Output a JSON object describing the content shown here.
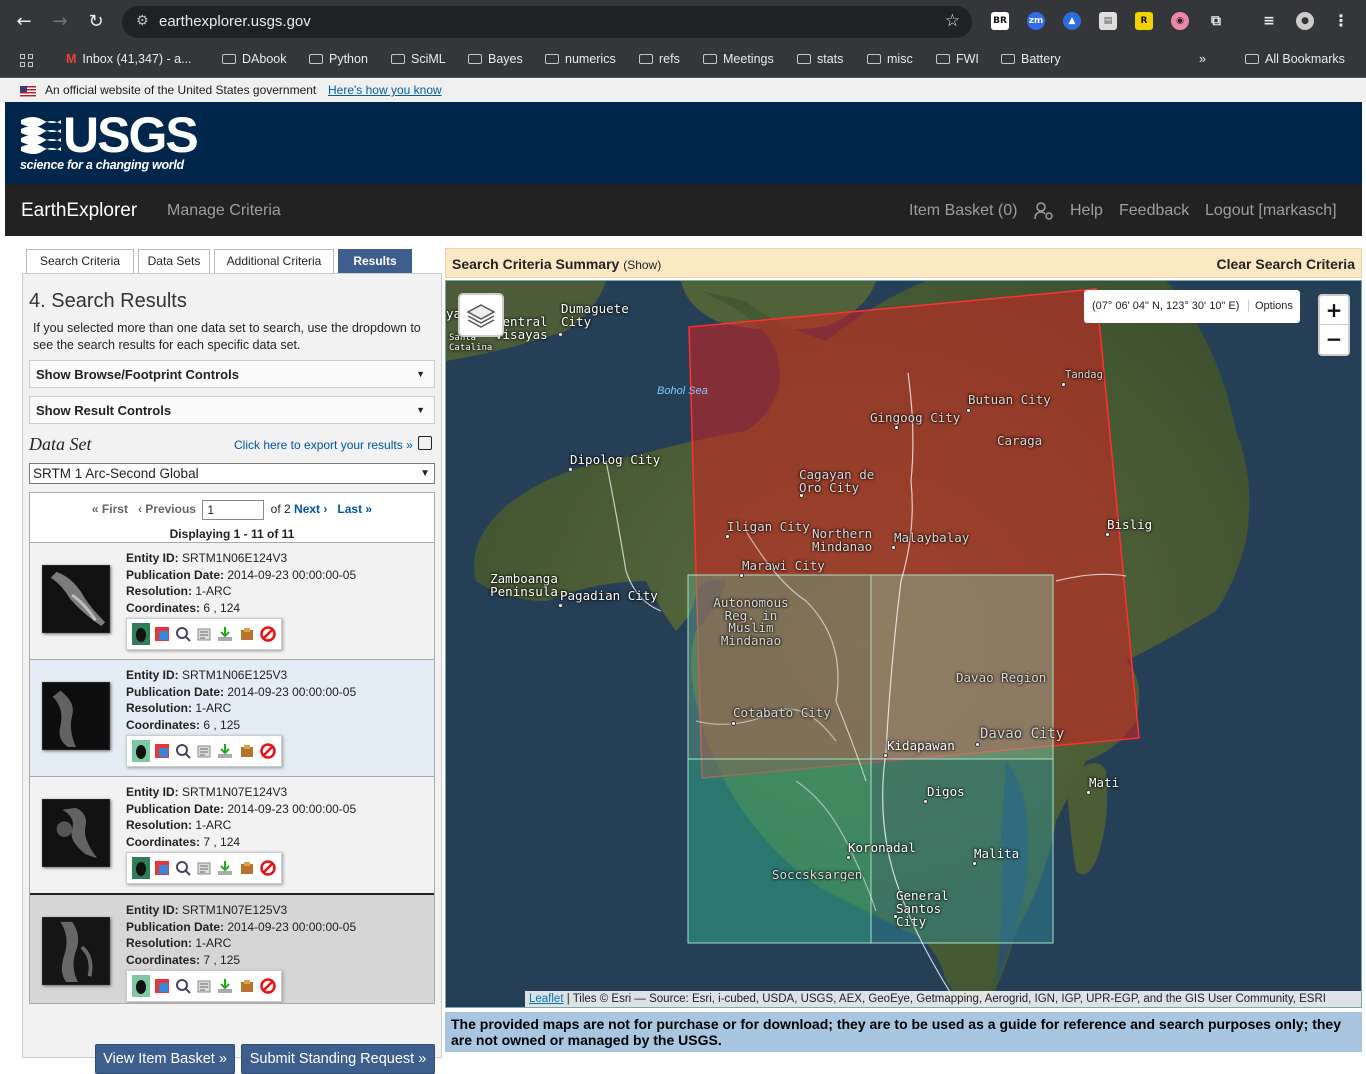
{
  "browser": {
    "url": "earthexplorer.usgs.gov",
    "bookmarks": [
      "Inbox (41,347) - a...",
      "DAbook",
      "Python",
      "SciML",
      "Bayes",
      "numerics",
      "refs",
      "Meetings",
      "stats",
      "misc",
      "FWI",
      "Battery"
    ],
    "all_bookmarks": "All Bookmarks",
    "overflow": "»"
  },
  "gov_banner": {
    "text": "An official website of the United States government",
    "link": "Here's how you know"
  },
  "header": {
    "logo_word": "USGS",
    "tagline": "science for a changing world"
  },
  "nav": {
    "brand": "EarthExplorer",
    "manage": "Manage Criteria",
    "item_basket": "Item Basket (0)",
    "help": "Help",
    "feedback": "Feedback",
    "logout": "Logout [markasch]"
  },
  "tabs": [
    "Search Criteria",
    "Data Sets",
    "Additional Criteria",
    "Results"
  ],
  "results": {
    "title": "4. Search Results",
    "description": "If you selected more than one data set to search, use the dropdown to see the search results for each specific data set.",
    "browse_controls": "Show Browse/Footprint Controls",
    "result_controls": "Show Result Controls",
    "dataset_label": "Data Set",
    "export_link": "Click here to export your results »",
    "dataset_selected": "SRTM 1 Arc-Second Global",
    "pager": {
      "first": "« First",
      "previous": "‹ Previous",
      "page_value": "1",
      "of_pages": "of 2",
      "next": "Next ›",
      "last": "Last »"
    },
    "displaying": "Displaying 1 - 11 of 11",
    "labels": {
      "entity": "Entity ID:",
      "publication": "Publication Date:",
      "resolution": "Resolution:",
      "coordinates": "Coordinates:"
    },
    "items": [
      {
        "entity_id": "SRTM1N06E124V3",
        "publication_date": "2014-09-23 00:00:00-05",
        "resolution": "1-ARC",
        "coordinates": "6 , 124"
      },
      {
        "entity_id": "SRTM1N06E125V3",
        "publication_date": "2014-09-23 00:00:00-05",
        "resolution": "1-ARC",
        "coordinates": "6 , 125"
      },
      {
        "entity_id": "SRTM1N07E124V3",
        "publication_date": "2014-09-23 00:00:00-05",
        "resolution": "1-ARC",
        "coordinates": "7 , 124"
      },
      {
        "entity_id": "SRTM1N07E125V3",
        "publication_date": "2014-09-23 00:00:00-05",
        "resolution": "1-ARC",
        "coordinates": "7 , 125"
      }
    ],
    "view_basket": "View Item Basket »",
    "standing_request": "Submit Standing Request »"
  },
  "criteria_bar": {
    "title": "Search Criteria Summary",
    "show": "(Show)",
    "clear": "Clear Search Criteria"
  },
  "map": {
    "coordinates": "(07° 06' 04\" N, 123° 30' 10\" E)",
    "options": "Options",
    "zoom_in": "+",
    "zoom_out": "−",
    "attribution_link": "Leaflet",
    "attribution_text": " | Tiles © Esri — Source: Esri, i-cubed, USDA, USGS, AEX, GeoEye, Getmapping, Aerogrid, IGN, IGP, UPR-EGP, and the GIS User Community, ESRI",
    "places": {
      "dumaguete": "Dumaguete City",
      "central": "Central Visayas",
      "ya": "ya",
      "santa": "Santa Catalina",
      "bohol": "Bohol Sea",
      "tandag": "Tandag",
      "butuan": "Butuan City",
      "gingoog": "Gingoog City",
      "caraga": "Caraga",
      "dipolog": "Dipolog City",
      "cagayan": "Cagayan de Oro City",
      "iligan": "Iligan City",
      "northern": "Northern Mindanao",
      "malaybalay": "Malaybalay",
      "bislig": "Bislig",
      "marawi": "Marawi City",
      "zamboanga": "Zamboanga Peninsula",
      "pagadian": "Pagadian City",
      "armm": "Autonomous Reg. in Muslim Mindanao",
      "davao_region": "Davao Region",
      "cotabato": "Cotabato City",
      "kidapawan": "Kidapawan",
      "davao_city": "Davao City",
      "mati": "Mati",
      "digos": "Digos",
      "koronadal": "Koronadal",
      "malita": "Malita",
      "soccsksargen": "Soccsksargen",
      "gensan": "General Santos City"
    }
  },
  "disclaimer": "The provided maps are not for purchase or for download; they are to be used as a guide for reference and search purposes only; they are not owned or managed by the USGS.",
  "colors": {
    "usgs_blue": "#00264c",
    "nav_dark": "#222222",
    "tab_active": "#3e5f8e",
    "criteria_bg": "#fde8c4",
    "search_polygon": "#d42020",
    "footprint": "#5fae8f"
  }
}
